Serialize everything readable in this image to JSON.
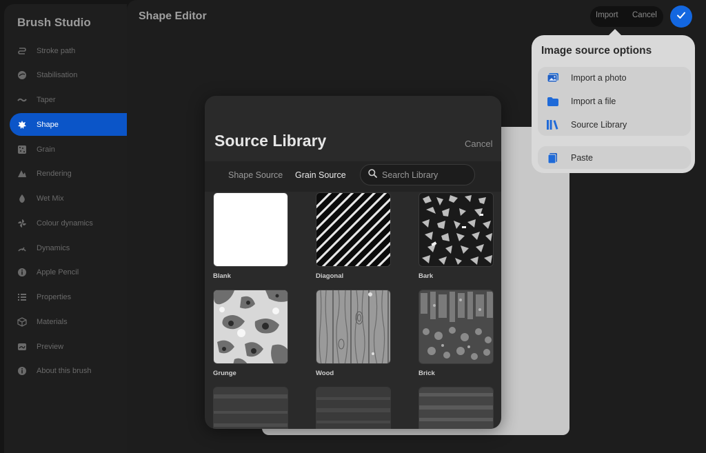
{
  "sidebar": {
    "title": "Brush Studio",
    "items": [
      {
        "label": "Stroke path",
        "icon": "stroke-path-icon"
      },
      {
        "label": "Stabilisation",
        "icon": "stabilisation-icon"
      },
      {
        "label": "Taper",
        "icon": "taper-icon"
      },
      {
        "label": "Shape",
        "icon": "shape-icon"
      },
      {
        "label": "Grain",
        "icon": "grain-icon"
      },
      {
        "label": "Rendering",
        "icon": "rendering-icon"
      },
      {
        "label": "Wet Mix",
        "icon": "wet-mix-icon"
      },
      {
        "label": "Colour dynamics",
        "icon": "colour-dynamics-icon"
      },
      {
        "label": "Dynamics",
        "icon": "dynamics-icon"
      },
      {
        "label": "Apple Pencil",
        "icon": "apple-pencil-icon"
      },
      {
        "label": "Properties",
        "icon": "properties-icon"
      },
      {
        "label": "Materials",
        "icon": "materials-icon"
      },
      {
        "label": "Preview",
        "icon": "preview-icon"
      },
      {
        "label": "About this brush",
        "icon": "about-icon"
      }
    ],
    "active": "Shape"
  },
  "editor": {
    "title": "Shape Editor",
    "import_label": "Import",
    "cancel_label": "Cancel"
  },
  "popover": {
    "title": "Image source options",
    "items": [
      {
        "label": "Import a photo",
        "icon": "photo-icon"
      },
      {
        "label": "Import a file",
        "icon": "folder-icon"
      },
      {
        "label": "Source Library",
        "icon": "library-icon"
      }
    ],
    "paste_label": "Paste"
  },
  "modal": {
    "title": "Source Library",
    "cancel_label": "Cancel",
    "tabs": [
      "Shape Source",
      "Grain Source"
    ],
    "active_tab": "Grain Source",
    "search_placeholder": "Search Library",
    "tiles": [
      {
        "label": "Blank"
      },
      {
        "label": "Diagonal"
      },
      {
        "label": "Bark"
      },
      {
        "label": "Grunge"
      },
      {
        "label": "Wood"
      },
      {
        "label": "Brick"
      },
      {
        "label": ""
      },
      {
        "label": ""
      },
      {
        "label": ""
      }
    ]
  },
  "colors": {
    "accent": "#1367e0",
    "sidebar_active": "#0b55c8",
    "popover_bg": "#d9d9d9",
    "modal_bg": "#2a2a2a"
  }
}
